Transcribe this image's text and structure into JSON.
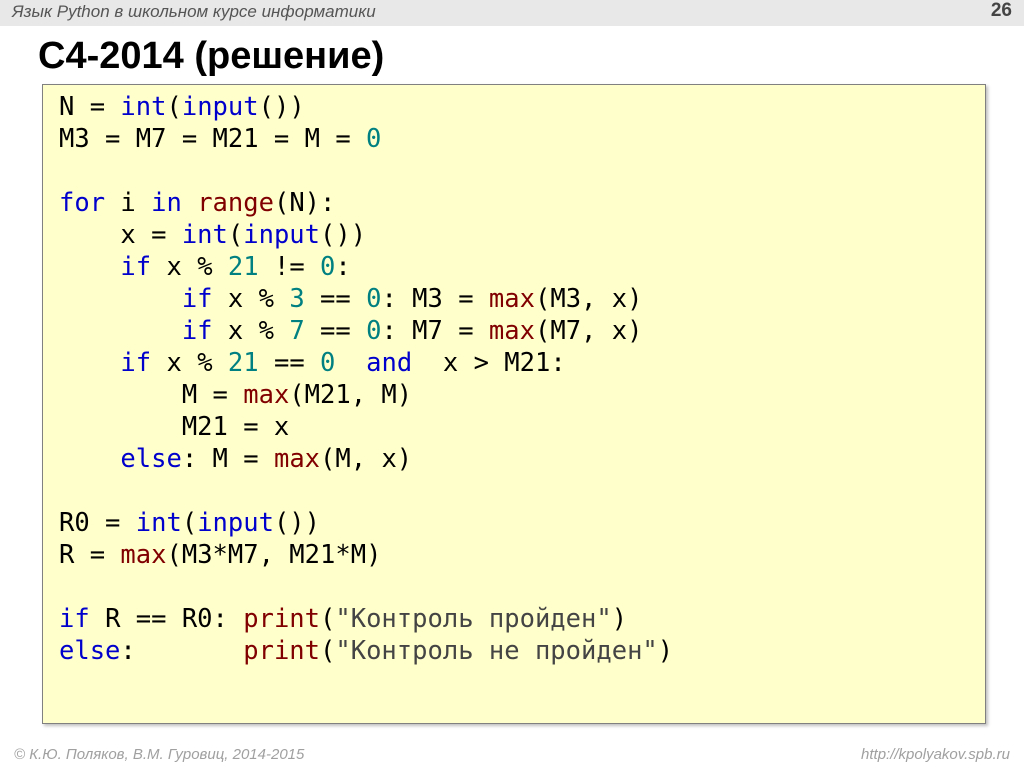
{
  "header": {
    "subject": "Язык Python в школьном курсе информатики",
    "page": "26"
  },
  "title": "С4-2014 (решение)",
  "code": {
    "l1": {
      "a": "N = ",
      "b": "int",
      "c": "(",
      "d": "input",
      "e": "())"
    },
    "l2": {
      "a": "M3 = M7 = M21 = M = ",
      "n": "0"
    },
    "l3": {
      "a": "for",
      "b": " i ",
      "c": "in",
      "d": " ",
      "e": "range",
      "f": "(N):"
    },
    "l4": {
      "a": "    x = ",
      "b": "int",
      "c": "(",
      "d": "input",
      "e": "())"
    },
    "l5": {
      "a": "    ",
      "b": "if",
      "c": " x % ",
      "n": "21",
      "d": " != ",
      "z": "0",
      "e": ":"
    },
    "l6": {
      "a": "        ",
      "b": "if",
      "c": " x % ",
      "n": "3",
      "d": " == ",
      "z": "0",
      "e": ": M3 = ",
      "f": "max",
      "g": "(M3, x)"
    },
    "l7": {
      "a": "        ",
      "b": "if",
      "c": " x % ",
      "n": "7",
      "d": " == ",
      "z": "0",
      "e": ": M7 = ",
      "f": "max",
      "g": "(M7, x)"
    },
    "l8": {
      "a": "    ",
      "b": "if",
      "c": " x % ",
      "n": "21",
      "d": " == ",
      "z": "0",
      "e": "  ",
      "f": "and",
      "g": "  x > M21:"
    },
    "l9": {
      "a": "        M = ",
      "b": "max",
      "c": "(M21, M)"
    },
    "l10": {
      "a": "        M21 = x"
    },
    "l11": {
      "a": "    ",
      "b": "else",
      "c": ": M = ",
      "d": "max",
      "e": "(M, x)"
    },
    "l12": {
      "a": "R0 = ",
      "b": "int",
      "c": "(",
      "d": "input",
      "e": "())"
    },
    "l13": {
      "a": "R = ",
      "b": "max",
      "c": "(M3*M7, M21*M)"
    },
    "l14": {
      "a": "if",
      "b": " R == R0: ",
      "c": "print",
      "d": "(",
      "s": "\"Контроль пройден\"",
      "e": ")"
    },
    "l15": {
      "a": "else",
      "b": ":       ",
      "c": "print",
      "d": "(",
      "s": "\"Контроль не пройден\"",
      "e": ")"
    }
  },
  "footer": {
    "left": "© К.Ю. Поляков, В.М. Гуровиц, 2014-2015",
    "right": "http://kpolyakov.spb.ru"
  }
}
